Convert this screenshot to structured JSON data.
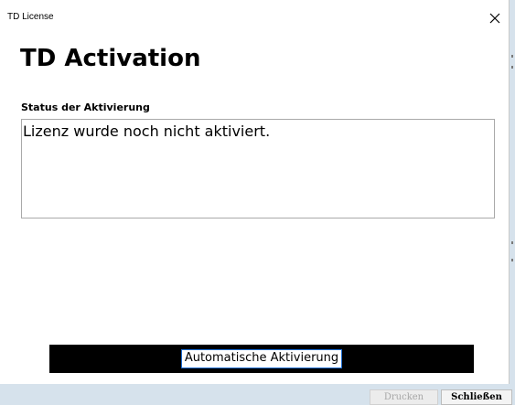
{
  "window": {
    "title": "TD License"
  },
  "dialog": {
    "heading": "TD Activation",
    "status_label": "Status der Aktivierung",
    "status_text": "Lizenz wurde noch nicht aktiviert.",
    "activate_button_label": "Automatische Aktivierung"
  },
  "footer": {
    "print_label": "Drucken",
    "close_label": "Schließen"
  },
  "icons": {
    "close": "close-icon"
  },
  "colors": {
    "window_background": "#ffffff",
    "bottom_bar": "#d6e2ec",
    "activate_button": "#000000",
    "focus_border": "#1a6bd1",
    "disabled_text": "#a6a6a6"
  }
}
